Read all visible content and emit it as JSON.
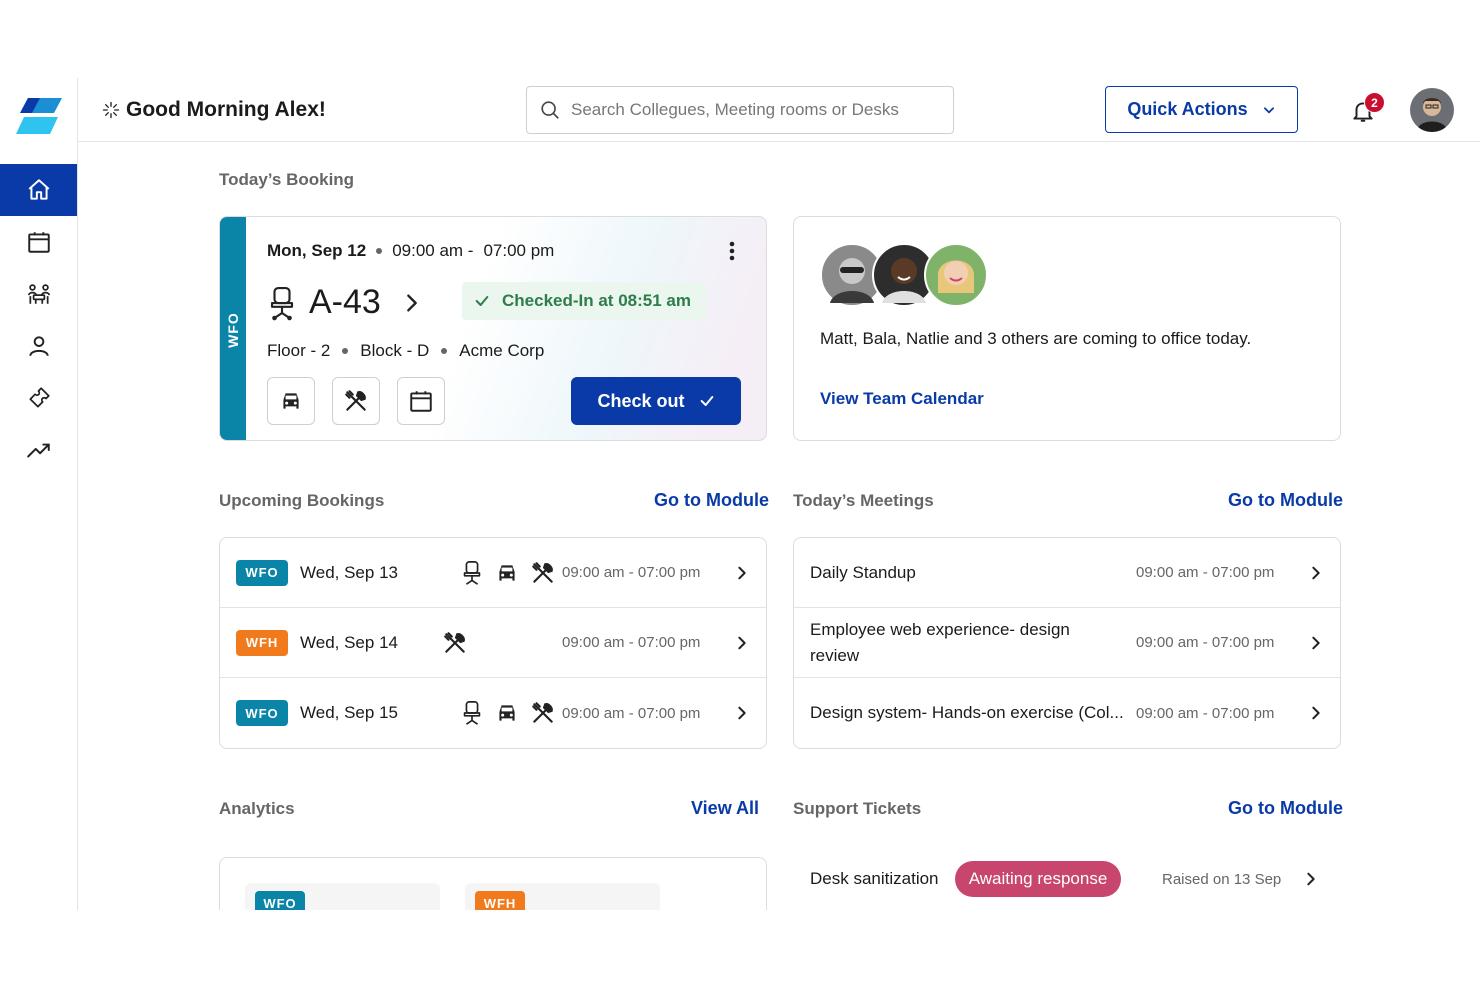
{
  "header": {
    "greeting": "Good Morning Alex!",
    "search_placeholder": "Search Collegues, Meeting rooms or Desks",
    "quick_actions_label": "Quick Actions",
    "notification_count": "2"
  },
  "sidebar": {
    "items": [
      {
        "name": "home-icon",
        "active": true
      },
      {
        "name": "calendar-icon",
        "active": false
      },
      {
        "name": "team-icon",
        "active": false
      },
      {
        "name": "person-icon",
        "active": false
      },
      {
        "name": "ticket-icon",
        "active": false
      },
      {
        "name": "analytics-icon",
        "active": false
      }
    ]
  },
  "todays_booking": {
    "section_label": "Today’s Booking",
    "tag": "WFO",
    "date": "Mon, Sep 12",
    "time_start": "09:00 am -",
    "time_end": "07:00 pm",
    "desk": "A-43",
    "status": "Checked-In at 08:51 am",
    "floor": "Floor - 2",
    "block": "Block - D",
    "company": "Acme Corp",
    "checkout_label": "Check out"
  },
  "team": {
    "message": "Matt, Bala, Natlie and 3 others are coming to office today.",
    "link": "View Team Calendar"
  },
  "upcoming": {
    "section_label": "Upcoming Bookings",
    "link": "Go to Module",
    "rows": [
      {
        "tag": "WFO",
        "date": "Wed, Sep 13",
        "time_start": "09:00 am -",
        "time_end": "07:00 pm"
      },
      {
        "tag": "WFH",
        "date": "Wed, Sep 14",
        "time_start": "09:00 am -",
        "time_end": "07:00 pm"
      },
      {
        "tag": "WFO",
        "date": "Wed, Sep 15",
        "time_start": "09:00 am -",
        "time_end": "07:00 pm"
      }
    ]
  },
  "meetings": {
    "section_label": "Today’s Meetings",
    "link": "Go to Module",
    "rows": [
      {
        "title": "Daily Standup",
        "time_start": "09:00 am -",
        "time_end": "07:00 pm"
      },
      {
        "title": "Employee web experience- design review",
        "time_start": "09:00 am -",
        "time_end": "07:00 pm"
      },
      {
        "title": "Design system- Hands-on exercise (Col...",
        "time_start": "09:00 am -",
        "time_end": "07:00 pm"
      }
    ]
  },
  "analytics": {
    "section_label": "Analytics",
    "link": "View All",
    "tiles": [
      {
        "tag": "WFO"
      },
      {
        "tag": "WFH"
      }
    ]
  },
  "support": {
    "section_label": "Support Tickets",
    "link": "Go to Module",
    "ticket": {
      "title": "Desk sanitization",
      "status": "Awaiting response",
      "raised": "Raised on 13 Sep"
    }
  },
  "colors": {
    "primary": "#0a3aa8",
    "wfo": "#0a85a8",
    "wfh": "#f07a1c",
    "checked_in": "#2e7d4a",
    "awaiting": "#c8456e",
    "badge": "#c8102e"
  }
}
